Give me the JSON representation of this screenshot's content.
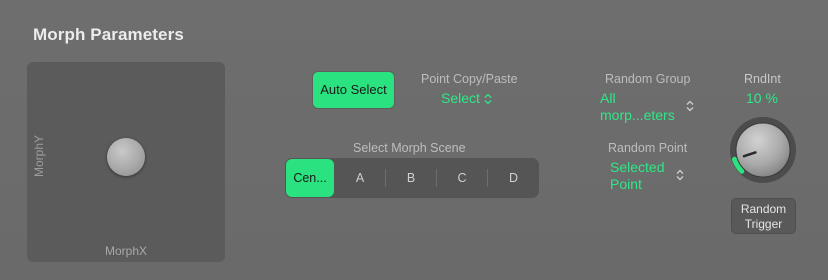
{
  "panel": {
    "title": "Morph Parameters"
  },
  "xy_pad": {
    "x_label": "MorphX",
    "y_label": "MorphY"
  },
  "auto_select": {
    "label": "Auto Select"
  },
  "point_copy_paste": {
    "label": "Point Copy/Paste",
    "value": "Select"
  },
  "morph_scene": {
    "label": "Select Morph Scene",
    "options": [
      "Cen...",
      "A",
      "B",
      "C",
      "D"
    ],
    "selected": "Cen..."
  },
  "random_group": {
    "label": "Random Group",
    "value_line1": "All",
    "value_line2": "morp...eters"
  },
  "random_point": {
    "label": "Random Point",
    "value_line1": "Selected",
    "value_line2": "Point"
  },
  "rnd_int": {
    "label": "RndInt",
    "value": "10 %",
    "level": 0.1
  },
  "random_trigger": {
    "label_line1": "Random",
    "label_line2": "Trigger"
  },
  "colors": {
    "accent": "#2ae27f",
    "panel": "#6b6b6b",
    "pad": "#5b5b5b"
  }
}
